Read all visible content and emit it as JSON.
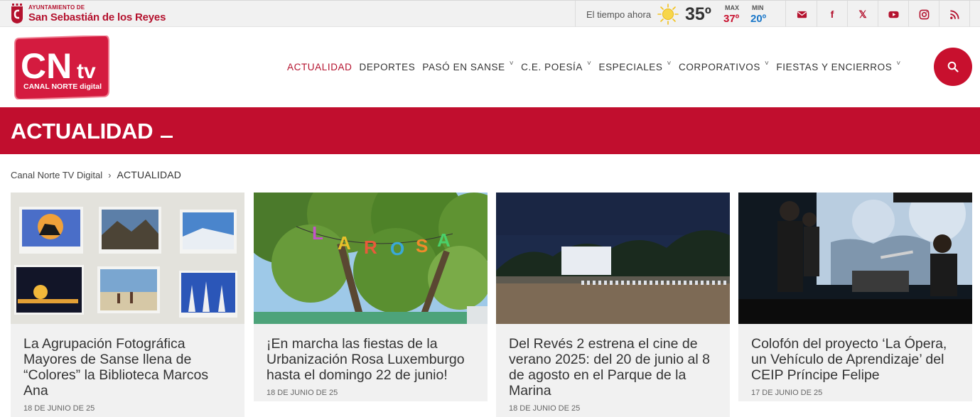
{
  "topbar": {
    "ayto_small": "AYUNTAMIENTO DE",
    "ayto_name": "San Sebastián de los Reyes",
    "weather": {
      "label": "El tiempo ahora",
      "icon": "sun-icon",
      "current": "35º",
      "max_label": "MAX",
      "max_value": "37º",
      "min_label": "MIN",
      "min_value": "20º"
    },
    "social": [
      {
        "name": "email-icon"
      },
      {
        "name": "facebook-icon",
        "glyph": "f"
      },
      {
        "name": "x-twitter-icon",
        "glyph": "𝕏"
      },
      {
        "name": "youtube-icon"
      },
      {
        "name": "instagram-icon"
      },
      {
        "name": "rss-icon"
      }
    ]
  },
  "header": {
    "logo_text": "CN",
    "logo_tv": "tv",
    "logo_sub": "CANAL NORTE digital",
    "nav": [
      {
        "label": "ACTUALIDAD",
        "active": true,
        "dropdown": false
      },
      {
        "label": "DEPORTES",
        "active": false,
        "dropdown": false
      },
      {
        "label": "PASÓ EN SANSE",
        "active": false,
        "dropdown": true
      },
      {
        "label": "C.E. POESÍA",
        "active": false,
        "dropdown": true
      },
      {
        "label": "ESPECIALES",
        "active": false,
        "dropdown": true
      },
      {
        "label": "CORPORATIVOS",
        "active": false,
        "dropdown": true
      },
      {
        "label": "FIESTAS Y ENCIERROS",
        "active": false,
        "dropdown": true
      }
    ],
    "chevron": "˅"
  },
  "banner": {
    "title": "ACTUALIDAD"
  },
  "breadcrumb": {
    "home": "Canal Norte TV Digital",
    "separator": "›",
    "current": "ACTUALIDAD"
  },
  "cards": [
    {
      "title": "La Agrupación Fotográfica Mayores de Sanse llena de “Colores” la Biblioteca Marcos Ana",
      "date": "18 DE JUNIO DE 25"
    },
    {
      "title": "¡En marcha las fiestas de la Urbanización Rosa Luxemburgo hasta el domingo 22 de junio!",
      "date": "18 DE JUNIO DE 25",
      "garland": [
        "L",
        "A",
        "R",
        "O",
        "S",
        "A"
      ]
    },
    {
      "title": "Del Revés 2 estrena el cine de verano 2025: del 20 de junio al 8 de agosto en el Parque de la Marina",
      "date": "18 DE JUNIO DE 25"
    },
    {
      "title": "Colofón del proyecto ‘La Ópera, un Vehículo de Aprendizaje’ del CEIP Príncipe Felipe",
      "date": "17 DE JUNIO DE 25"
    }
  ],
  "colors": {
    "brand_red": "#c10e2e",
    "accent_red": "#c8102e",
    "min_blue": "#1a77c9"
  }
}
